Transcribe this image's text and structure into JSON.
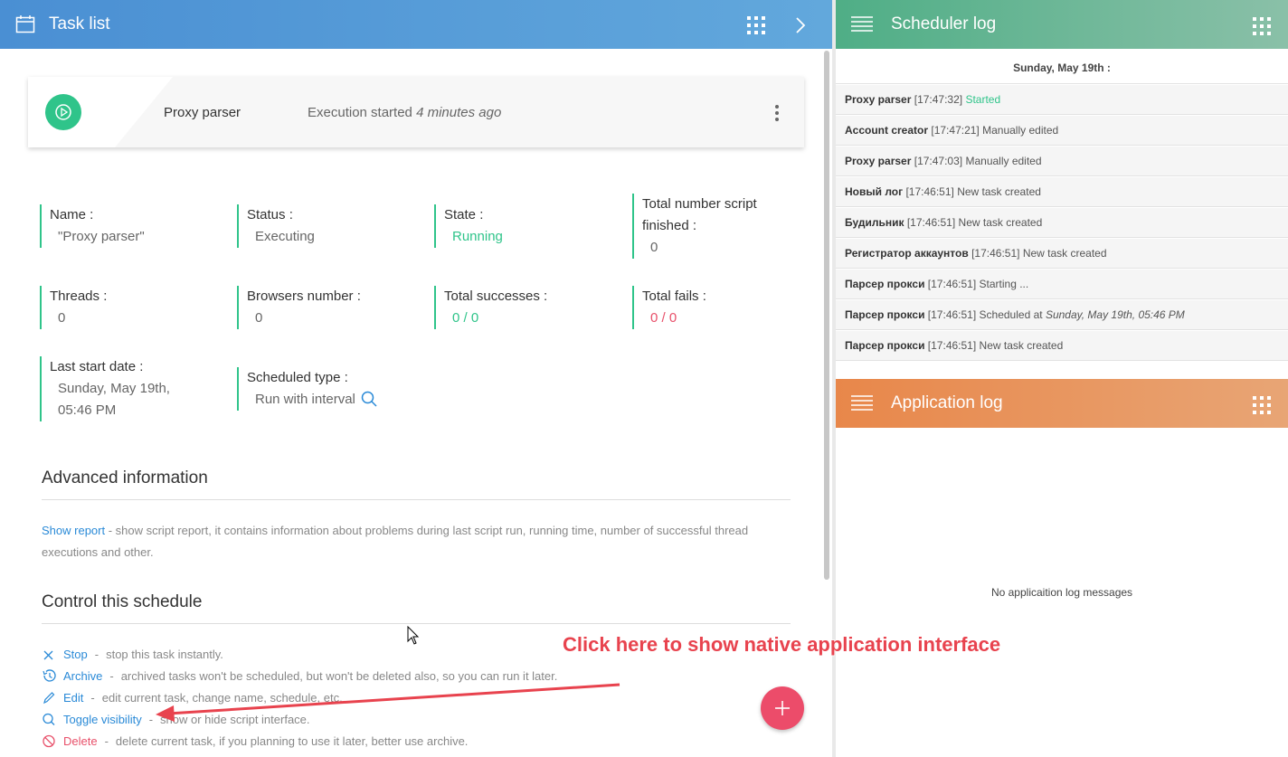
{
  "task_list": {
    "title": "Task list",
    "card": {
      "name": "Proxy parser",
      "exec_prefix": "Execution started",
      "exec_time": "4 minutes ago"
    },
    "fields": {
      "name_label": "Name :",
      "name_value": "\"Proxy parser\"",
      "status_label": "Status :",
      "status_value": "Executing",
      "state_label": "State :",
      "state_value": "Running",
      "total_finished_label_1": "Total number script",
      "total_finished_label_2": "finished :",
      "total_finished_value": "0",
      "threads_label": "Threads :",
      "threads_value": "0",
      "browsers_label": "Browsers number :",
      "browsers_value": "0",
      "successes_label": "Total successes :",
      "successes_value": "0 / 0",
      "fails_label": "Total fails :",
      "fails_value": "0 / 0",
      "last_start_label": "Last start date :",
      "last_start_value_1": "Sunday, May 19th,",
      "last_start_value_2": "05:46 PM",
      "sched_type_label": "Scheduled type :",
      "sched_type_value": "Run with interval"
    },
    "advanced": {
      "title": "Advanced information",
      "show_report_link": "Show report",
      "show_report_desc": " - show script report, it contains information about problems during last script run, running time, number of successful thread executions and other."
    },
    "control": {
      "title": "Control this schedule",
      "items": [
        {
          "label": "Stop",
          "desc": "stop this task instantly.",
          "icon": "close-icon"
        },
        {
          "label": "Archive",
          "desc": "archived tasks won't be scheduled, but won't be deleted also, so you can run it later.",
          "icon": "history-icon"
        },
        {
          "label": "Edit",
          "desc": "edit current task, change name, schedule, etc.",
          "icon": "pencil-icon"
        },
        {
          "label": "Toggle visibility",
          "desc": "show or hide script interface.",
          "icon": "search-icon"
        },
        {
          "label": "Delete",
          "desc": "delete current task, if you planning to use it later, better use archive.",
          "icon": "block-icon"
        }
      ]
    }
  },
  "scheduler_log": {
    "title": "Scheduler log",
    "date": "Sunday, May 19th :",
    "entries": [
      {
        "name": "Proxy parser",
        "time": "[17:47:32]",
        "msg": "Started",
        "italic": ""
      },
      {
        "name": "Account creator",
        "time": "[17:47:21]",
        "msg": "Manually edited",
        "italic": ""
      },
      {
        "name": "Proxy parser",
        "time": "[17:47:03]",
        "msg": "Manually edited",
        "italic": ""
      },
      {
        "name": "Новый лог",
        "time": "[17:46:51]",
        "msg": "New task created",
        "italic": ""
      },
      {
        "name": "Будильник",
        "time": "[17:46:51]",
        "msg": "New task created",
        "italic": ""
      },
      {
        "name": "Регистратор аккаунтов",
        "time": "[17:46:51]",
        "msg": "New task created",
        "italic": ""
      },
      {
        "name": "Парсер прокси",
        "time": "[17:46:51]",
        "msg": "Starting ...",
        "italic": ""
      },
      {
        "name": "Парсер прокси",
        "time": "[17:46:51]",
        "msg": "Scheduled at",
        "italic": "Sunday, May 19th, 05:46 PM"
      },
      {
        "name": "Парсер прокси",
        "time": "[17:46:51]",
        "msg": "New task created",
        "italic": ""
      }
    ]
  },
  "application_log": {
    "title": "Application log",
    "empty": "No applicaition log messages"
  },
  "annotation": {
    "text": "Click here to show native application interface"
  },
  "colors": {
    "accent_blue": "#4a8fd3",
    "accent_green": "#2fc48a",
    "accent_red": "#e8506a",
    "header_green": "#4fae86",
    "header_orange": "#e8874a"
  }
}
